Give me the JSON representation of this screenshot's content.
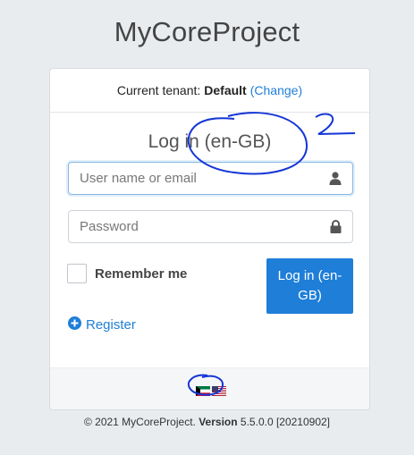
{
  "app": {
    "title": "MyCoreProject"
  },
  "tenant": {
    "label": "Current tenant:",
    "name": "Default",
    "open_paren": "(",
    "change_link": "Change",
    "close_paren": ")"
  },
  "login": {
    "title": "Log in (en-GB)",
    "username_placeholder": "User name or email",
    "password_placeholder": "Password",
    "remember_label": "Remember me",
    "remember_checked": false,
    "submit_label": "Log in (en-GB)",
    "register_label": "Register"
  },
  "languages": [
    {
      "name": "kuwait-flag-icon"
    },
    {
      "name": "us-flag-icon"
    }
  ],
  "footer": {
    "copyright": "© 2021 MyCoreProject.",
    "version_label": "Version",
    "version": "5.5.0.0 [20210902]"
  },
  "colors": {
    "primary": "#1e7ed8",
    "background": "#e9ecef",
    "annotation_ink": "#1536d6"
  },
  "annotation": {
    "text": "2"
  }
}
